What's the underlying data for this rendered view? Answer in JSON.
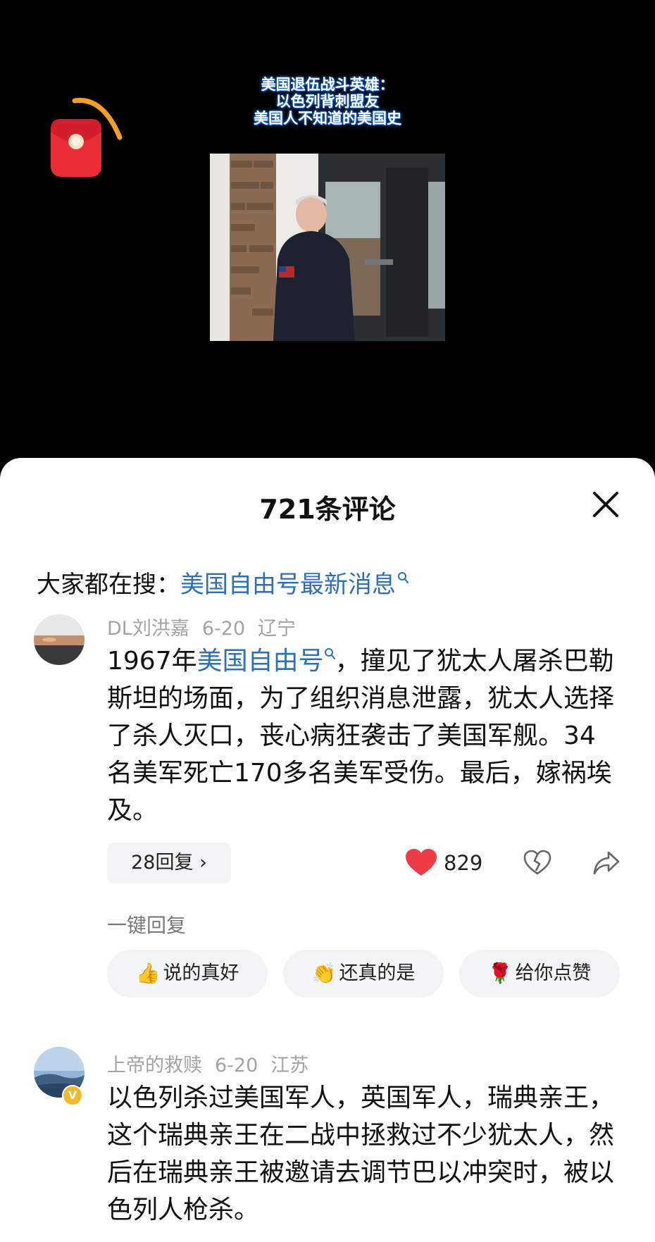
{
  "video": {
    "caption_lines": [
      "美国退伍战斗英雄：",
      "以色列背刺盟友",
      "美国人不知道的美国史"
    ]
  },
  "comments_panel": {
    "title": "721条评论",
    "trending": {
      "label": "大家都在搜：",
      "keyword": "美国自由号最新消息"
    },
    "comments": [
      {
        "author": "DL刘洪嘉",
        "date": "6-20",
        "location": "辽宁",
        "text_before": "1967年",
        "keyword": "美国自由号",
        "text_after": "，撞见了犹太人屠杀巴勒斯坦的场面，为了组织消息泄露，犹太人选择了杀人灭口，丧心病狂袭击了美国军舰。34名美军死亡170多名美军受伤。最后，嫁祸埃及。",
        "replies_label": "28回复 ›",
        "likes": "829"
      },
      {
        "author": "上帝的救赎",
        "date": "6-20",
        "location": "江苏",
        "text": "以色列杀过美国军人，英国军人，瑞典亲王，这个瑞典亲王在二战中拯救过不少犹太人，然后在瑞典亲王被邀请去调节巴以冲突时，被以色列人枪杀。",
        "verified_badge": "V"
      }
    ],
    "quick_reply": {
      "label": "一键回复",
      "options": [
        {
          "emoji": "👍",
          "text": "说的真好"
        },
        {
          "emoji": "👏",
          "text": "还真的是"
        },
        {
          "emoji": "🌹",
          "text": "给你点赞"
        }
      ]
    }
  },
  "colors": {
    "link": "#2f6fb5",
    "like": "#ee3b45",
    "meta": "#a3a3a3"
  },
  "icons": [
    "red-packet-icon",
    "close-icon",
    "search-icon",
    "heart-filled-icon",
    "dislike-heart-icon",
    "share-icon",
    "verified-badge-icon"
  ]
}
